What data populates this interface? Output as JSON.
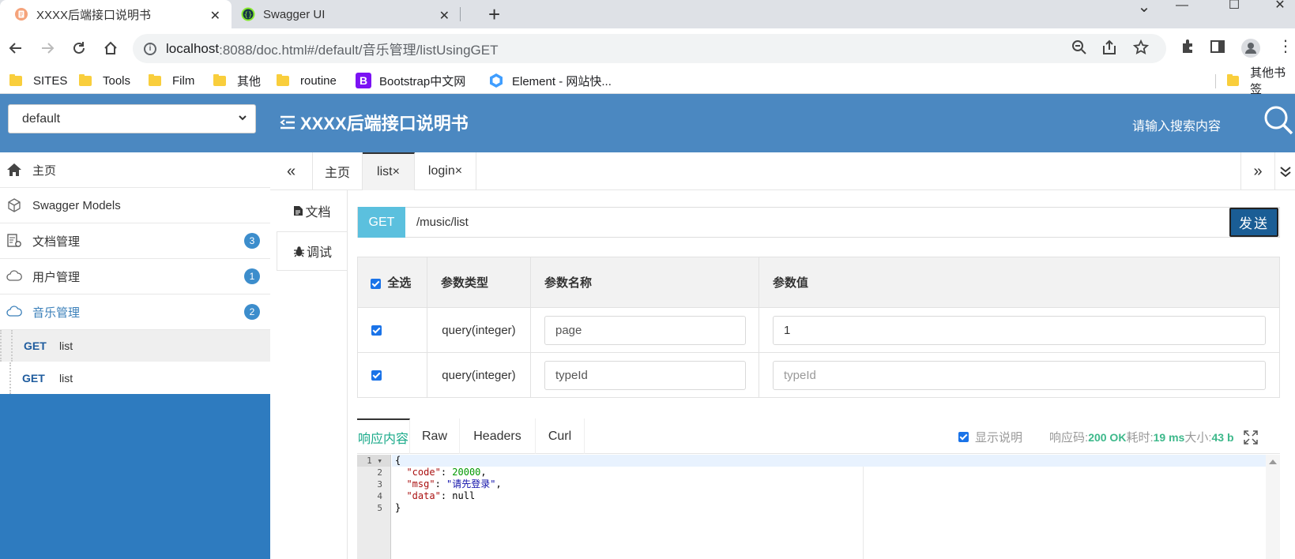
{
  "browser": {
    "tabs": [
      {
        "title": "XXXX后端接口说明书",
        "icon": "document-icon",
        "active": true
      },
      {
        "title": "Swagger UI",
        "icon": "swagger-icon",
        "active": false
      }
    ],
    "close_glyph": "✕",
    "new_tab_glyph": "+",
    "window_controls": {
      "minimize": "—",
      "maximize": "☐",
      "close": "✕",
      "tabsearch": "⌄"
    },
    "address": {
      "host": "localhost",
      "rest": ":8088/doc.html#/default/音乐管理/listUsingGET"
    },
    "bookmarks": [
      {
        "label": "SITES",
        "icon": "folder-icon"
      },
      {
        "label": "Tools",
        "icon": "folder-icon"
      },
      {
        "label": "Film",
        "icon": "folder-icon"
      },
      {
        "label": "其他",
        "icon": "folder-icon"
      },
      {
        "label": "routine",
        "icon": "folder-icon"
      },
      {
        "label": "Bootstrap中文网",
        "icon": "bootstrap-icon"
      },
      {
        "label": "Element - 网站快...",
        "icon": "element-icon"
      }
    ],
    "other_bookmarks": "其他书签"
  },
  "app": {
    "group_select": "default",
    "title": "XXXX后端接口说明书",
    "search_placeholder": "请输入搜索内容",
    "accent_color": "#4b88c1"
  },
  "sidebar": {
    "items": [
      {
        "label": "主页",
        "icon": "home-icon",
        "badge": ""
      },
      {
        "label": "Swagger Models",
        "icon": "cube-icon",
        "badge": ""
      },
      {
        "label": "文档管理",
        "icon": "doc-settings-icon",
        "badge": "3"
      },
      {
        "label": "用户管理",
        "icon": "cloud-icon",
        "badge": "1"
      },
      {
        "label": "音乐管理",
        "icon": "cloud-icon",
        "badge": "2"
      }
    ],
    "sub_items": [
      {
        "method": "GET",
        "label": "list"
      },
      {
        "method": "GET",
        "label": "list"
      }
    ]
  },
  "content_tabs": {
    "prev": "«",
    "next": "»",
    "more": "⌄",
    "tabs": [
      {
        "label": "主页"
      },
      {
        "label": "list×"
      },
      {
        "label": "login×"
      }
    ]
  },
  "side_tabs": [
    {
      "label": "文档",
      "icon": "file-icon"
    },
    {
      "label": "调试",
      "icon": "bug-icon"
    }
  ],
  "request": {
    "method": "GET",
    "url": "/music/list",
    "send_label": "发送"
  },
  "params": {
    "headers": [
      "全选",
      "参数类型",
      "参数名称",
      "参数值"
    ],
    "rows": [
      {
        "checked": true,
        "type": "query(integer)",
        "name": "page",
        "value": "1",
        "value_placeholder": ""
      },
      {
        "checked": true,
        "type": "query(integer)",
        "name": "typeId",
        "value": "",
        "value_placeholder": "typeId"
      }
    ]
  },
  "response": {
    "tabs": [
      "响应内容",
      "Raw",
      "Headers",
      "Curl"
    ],
    "show_desc_label": "显示说明",
    "status_label": "响应码:",
    "status_value": "200 OK",
    "time_label": "耗时:",
    "time_value": "19 ms",
    "size_label": "大小:",
    "size_value": "43 b",
    "line_numbers": [
      "1",
      "2",
      "3",
      "4",
      "5"
    ],
    "code": {
      "open": "{",
      "code_key": "\"code\"",
      "code_value": "20000",
      "msg_key": "\"msg\"",
      "msg_value": "\"请先登录\"",
      "data_key": "\"data\"",
      "data_value": "null",
      "close": "}"
    }
  }
}
